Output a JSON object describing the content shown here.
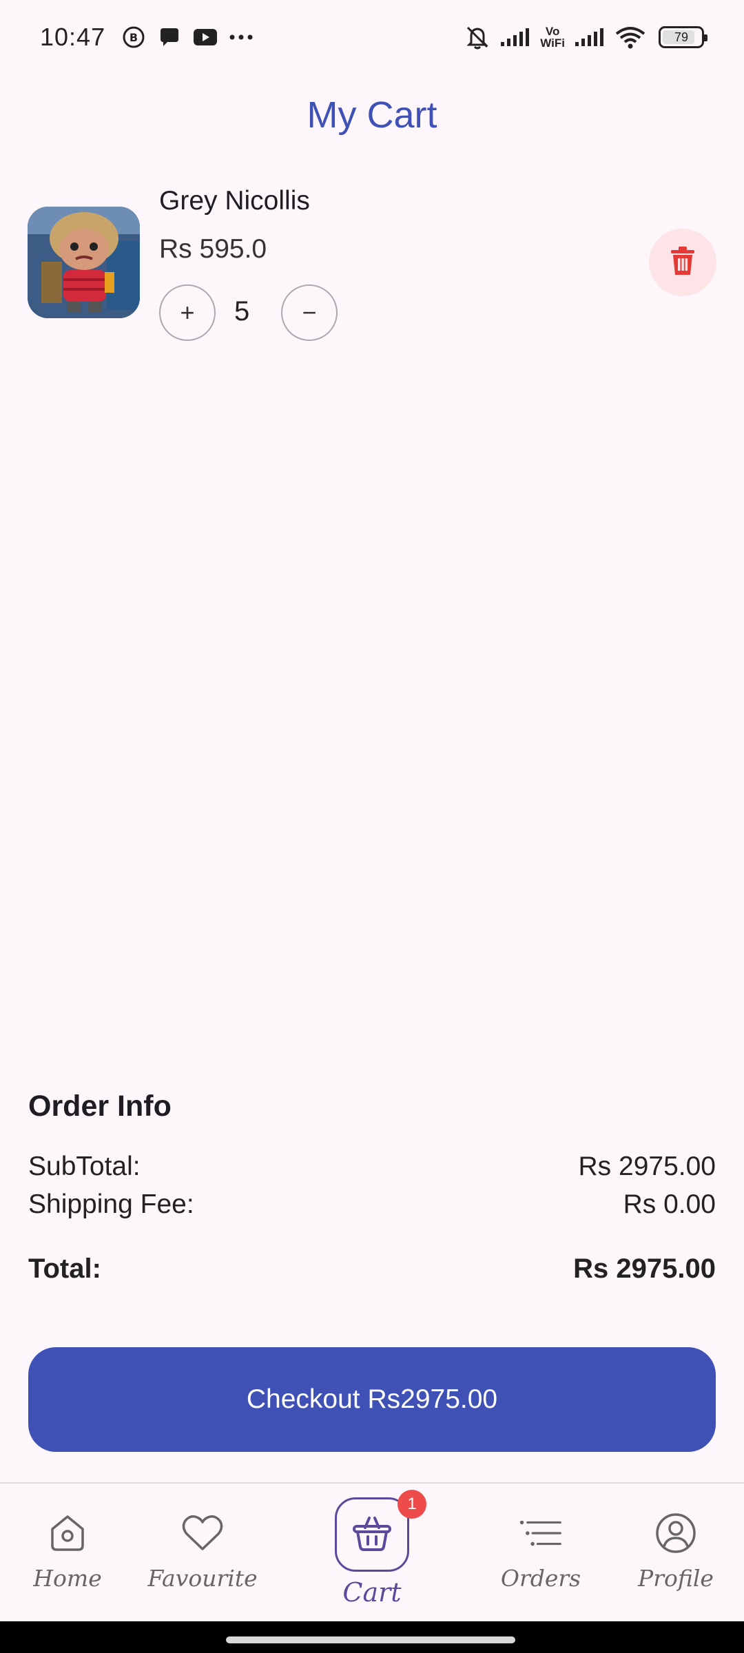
{
  "status_bar": {
    "time": "10:47",
    "battery": "79",
    "vowifi_top": "Vo",
    "vowifi_bottom": "WiFi",
    "icons": [
      "b-app-icon",
      "chat-icon",
      "youtube-icon",
      "more-icon",
      "bell-off-icon",
      "signal-icon",
      "signal-icon",
      "wifi-icon",
      "battery-icon"
    ]
  },
  "page": {
    "title": "My Cart"
  },
  "cart": {
    "items": [
      {
        "name": "Grey Nicollis",
        "price": "Rs 595.0",
        "quantity": "5",
        "plus": "+",
        "minus": "−"
      }
    ]
  },
  "order_info": {
    "title": "Order Info",
    "subtotal_label": "SubTotal:",
    "subtotal_value": "Rs 2975.00",
    "shipping_label": "Shipping Fee:",
    "shipping_value": "Rs 0.00",
    "total_label": "Total:",
    "total_value": "Rs 2975.00"
  },
  "checkout": {
    "label": "Checkout Rs2975.00"
  },
  "nav": {
    "home": "Home",
    "favourite": "Favourite",
    "cart": "Cart",
    "cart_badge": "1",
    "orders": "Orders",
    "profile": "Profile"
  },
  "colors": {
    "accent": "#3f51b5",
    "background": "#fdf6fb",
    "delete_bg": "#fde4e6",
    "delete_icon": "#e53935",
    "badge": "#ee4b4b",
    "cart_nav": "#5b4a9b"
  }
}
